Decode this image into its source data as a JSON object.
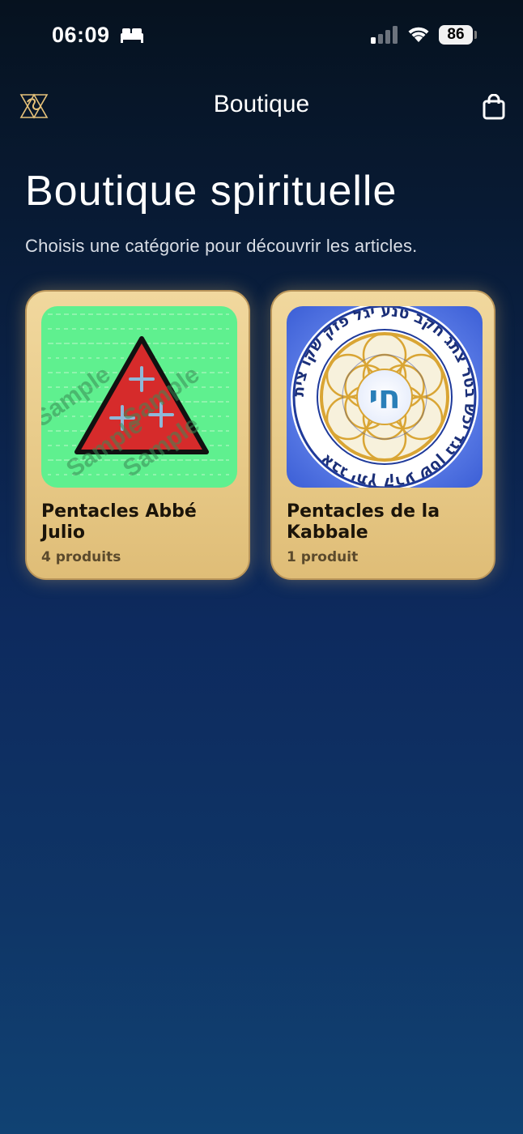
{
  "status_bar": {
    "time": "06:09",
    "battery": "86",
    "icons": [
      "bed-icon",
      "cellular-signal-icon",
      "wifi-icon",
      "battery-icon"
    ]
  },
  "nav": {
    "title": "Boutique",
    "left_icon": "app-logo-icon",
    "right_icon": "shopping-bag-icon"
  },
  "header": {
    "title": "Boutique spirituelle",
    "subtitle": "Choisis une catégorie pour découvrir les articles."
  },
  "categories": [
    {
      "title": "Pentacles Abbé Julio",
      "count": "4 produits",
      "image_watermark": "Sample",
      "colors": {
        "background": "#5ff08f",
        "triangle": "#d62b2b"
      }
    },
    {
      "title": "Pentacles de la Kabbale",
      "count": "1 produit",
      "image_center_text": "חי",
      "image_ring_text": "אבג יתץ קרע שטן נגד יכש בטר צתג חקב טנע יגל פזק שקו צית",
      "colors": {
        "background": "#4b6fe0",
        "gold": "#d9a534"
      }
    }
  ]
}
